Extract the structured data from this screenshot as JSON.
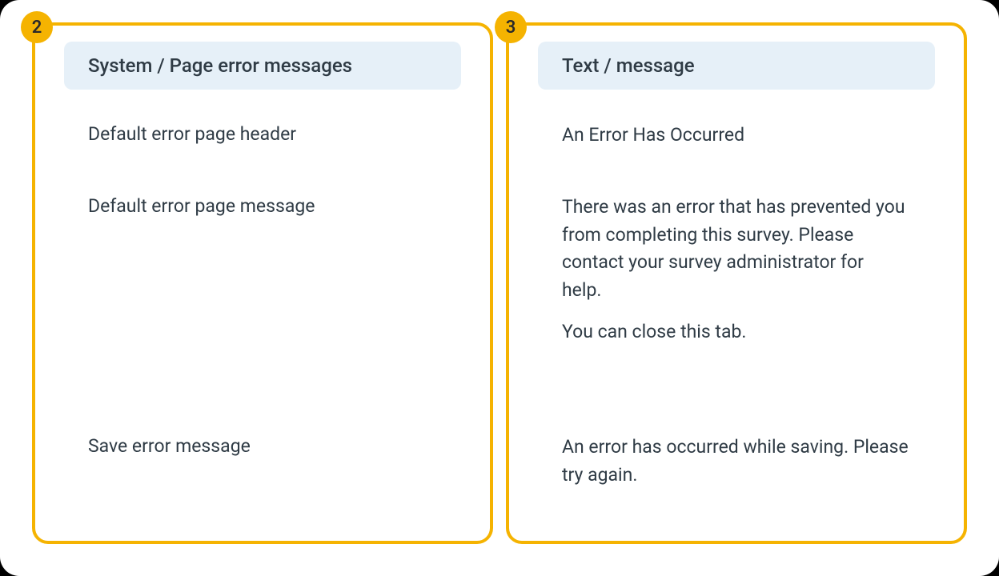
{
  "left": {
    "badge": "2",
    "header": "System / Page error messages",
    "rows": [
      "Default error page header",
      "Default error page message",
      "Save error message"
    ]
  },
  "right": {
    "badge": "3",
    "header": "Text / message",
    "rows": [
      {
        "parts": [
          "An Error Has Occurred"
        ]
      },
      {
        "parts": [
          "There was an error that has prevented you from completing this survey. Please contact your survey administrator for help.",
          "You can close this tab."
        ]
      },
      {
        "parts": [
          "An error has occurred while saving. Please try again."
        ]
      }
    ]
  }
}
